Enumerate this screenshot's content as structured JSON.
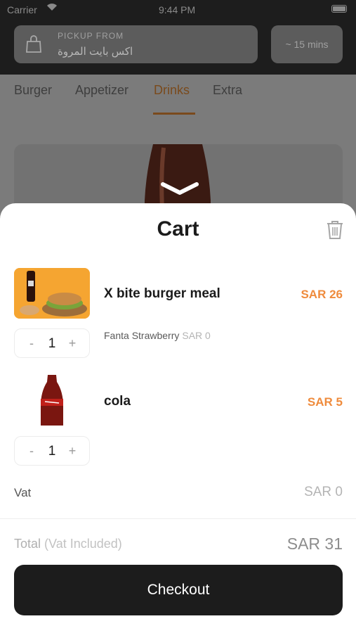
{
  "status_bar": {
    "carrier": "Carrier",
    "time": "9:44 PM"
  },
  "header": {
    "pickup_label": "PICKUP FROM",
    "pickup_location": "اكس بايت المروة",
    "eta": "~ 15 mins"
  },
  "tabs": [
    {
      "label": "Burger",
      "active": false
    },
    {
      "label": "Appetizer",
      "active": false
    },
    {
      "label": "Drinks",
      "active": true
    },
    {
      "label": "Extra",
      "active": false
    }
  ],
  "cart": {
    "title": "Cart",
    "items": [
      {
        "name": "X bite burger meal",
        "price": "SAR 26",
        "quantity": "1",
        "option": "Fanta Strawberry",
        "option_price": "SAR 0",
        "image": "burger-meal-photo"
      },
      {
        "name": "cola",
        "price": "SAR 5",
        "quantity": "1",
        "image": "cola-bottle-photo"
      }
    ],
    "stepper": {
      "minus": "-",
      "plus": "+"
    },
    "vat_label": "Vat",
    "vat_value": "SAR 0",
    "total_label": "Total",
    "total_note": "(Vat Included)",
    "total_value": "SAR 31",
    "checkout_label": "Checkout"
  },
  "colors": {
    "accent": "#ef8b3c",
    "dark": "#1c1c1c",
    "sheet": "#ffffff"
  }
}
